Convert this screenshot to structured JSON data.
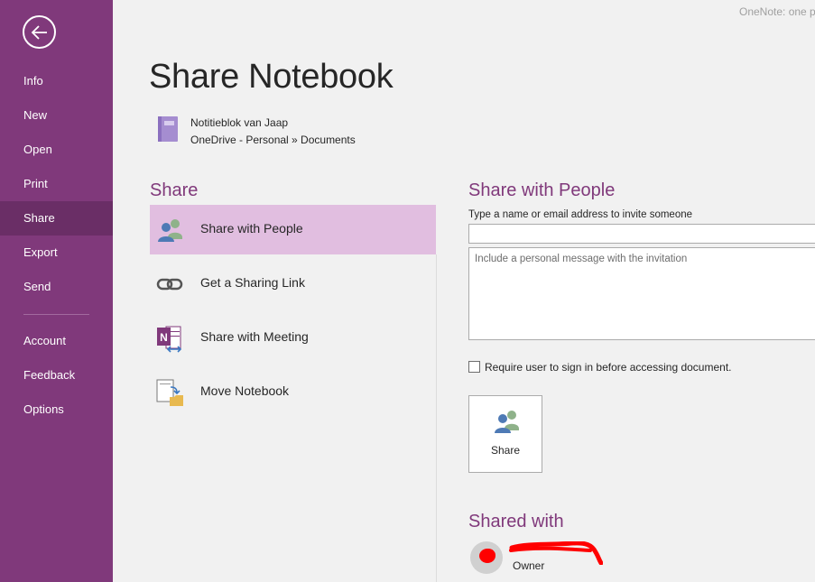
{
  "app": {
    "title_fragment": "OneNote: one p"
  },
  "sidebar": {
    "back_icon": "back-arrow-icon",
    "items": [
      {
        "label": "Info",
        "active": false
      },
      {
        "label": "New",
        "active": false
      },
      {
        "label": "Open",
        "active": false
      },
      {
        "label": "Print",
        "active": false
      },
      {
        "label": "Share",
        "active": true
      },
      {
        "label": "Export",
        "active": false
      },
      {
        "label": "Send",
        "active": false
      },
      {
        "label": "Account",
        "active": false
      },
      {
        "label": "Feedback",
        "active": false
      },
      {
        "label": "Options",
        "active": false
      }
    ]
  },
  "main": {
    "title": "Share Notebook",
    "notebook": {
      "name": "Notitieblok van Jaap",
      "location": "OneDrive - Personal » Documents",
      "icon": "notebook-icon"
    },
    "share_section": {
      "heading": "Share",
      "options": [
        {
          "label": "Share with People",
          "icon": "people-icon",
          "active": true
        },
        {
          "label": "Get a Sharing Link",
          "icon": "link-icon",
          "active": false
        },
        {
          "label": "Share with Meeting",
          "icon": "onenote-meeting-icon",
          "active": false
        },
        {
          "label": "Move Notebook",
          "icon": "move-notebook-icon",
          "active": false
        }
      ]
    },
    "share_with_people": {
      "heading": "Share with People",
      "invite_label": "Type a name or email address to invite someone",
      "invite_value": "",
      "message_placeholder": "Include a personal message with the invitation",
      "require_signin_label": "Require user to sign in before accessing document.",
      "require_signin_checked": false,
      "share_button_label": "Share"
    },
    "shared_with": {
      "heading": "Shared with",
      "people": [
        {
          "role": "Owner"
        }
      ]
    }
  },
  "colors": {
    "accent": "#80397b",
    "active_nav": "#6a2e66",
    "active_option": "#e1bee0"
  }
}
